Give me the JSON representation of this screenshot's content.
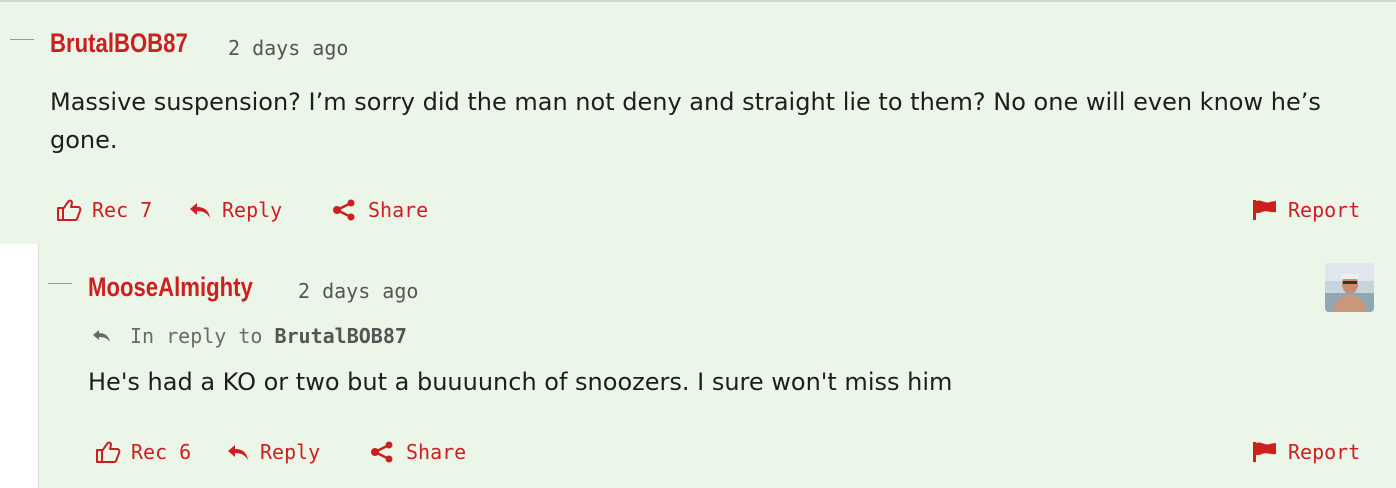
{
  "colors": {
    "accent": "#cc1f1f",
    "comment_background": "#ebf6e8",
    "body_text": "#1e1e1e",
    "meta_text": "#555555"
  },
  "comments": [
    {
      "author": "BrutalBOB87",
      "timestamp": "2 days ago",
      "body": "Massive suspension? I’m sorry did the man not deny and straight lie to them? No one will even know he’s gone.",
      "actions": {
        "rec_label": "Rec",
        "rec_count": "7",
        "reply_label": "Reply",
        "share_label": "Share",
        "report_label": "Report"
      },
      "icons": [
        "thumbs-up-icon",
        "reply-arrow-icon",
        "share-icon",
        "flag-icon"
      ]
    },
    {
      "author": "MooseAlmighty",
      "timestamp": "2 days ago",
      "in_reply_prefix": "In reply to",
      "in_reply_target": "BrutalBOB87",
      "body": "He's had a KO or two but a buuuunch of snoozers. I sure won't miss him",
      "actions": {
        "rec_label": "Rec",
        "rec_count": "6",
        "reply_label": "Reply",
        "share_label": "Share",
        "report_label": "Report"
      },
      "icons": [
        "thumbs-up-icon",
        "reply-arrow-icon",
        "share-icon",
        "flag-icon",
        "avatar"
      ]
    }
  ]
}
